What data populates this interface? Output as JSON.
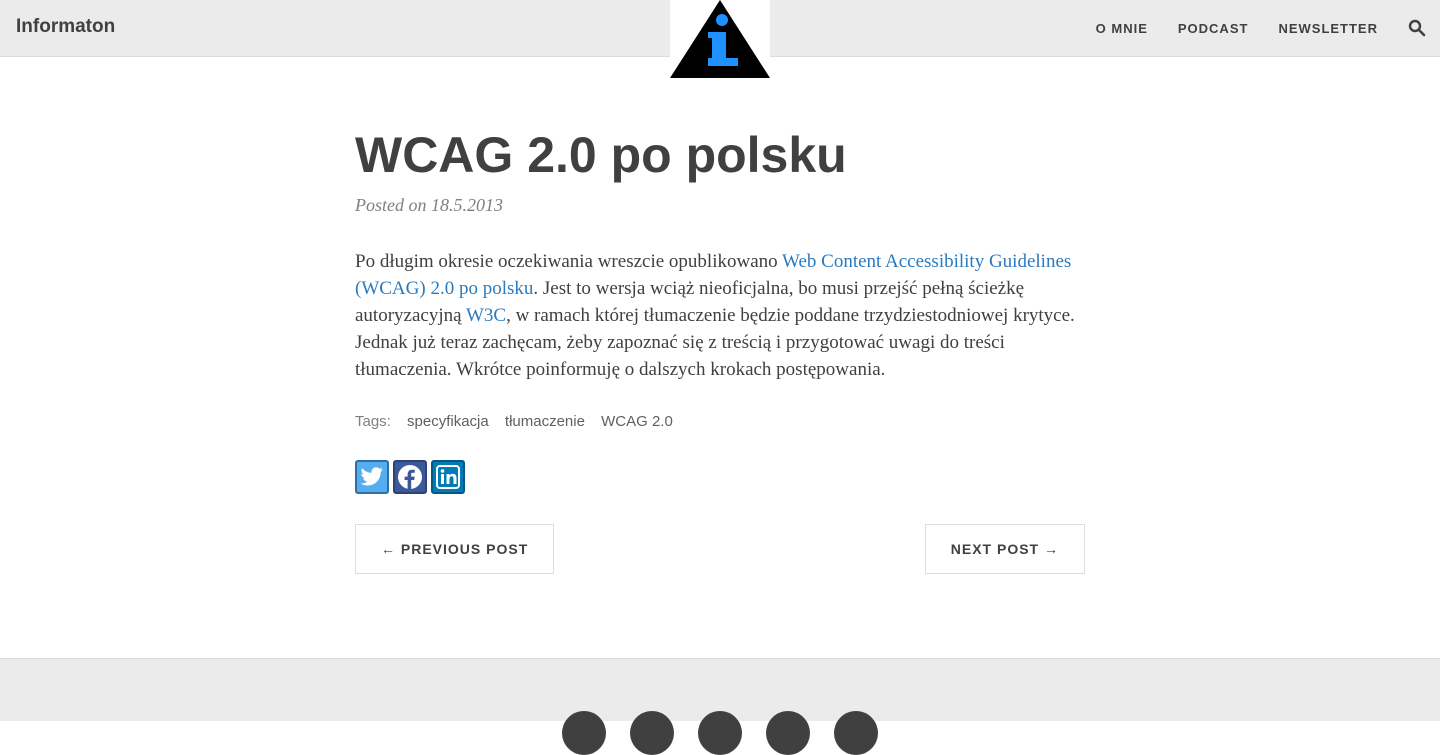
{
  "brand": "Informaton",
  "logo": {
    "icon": "info-triangle-logo",
    "colors": {
      "triangle": "#000000",
      "letter": "#1e90ff"
    }
  },
  "nav": {
    "items": [
      "O MNIE",
      "PODCAST",
      "NEWSLETTER"
    ],
    "search_icon": "search-icon"
  },
  "post": {
    "title": "WCAG 2.0 po polsku",
    "meta": "Posted on 18.5.2013",
    "body": {
      "p1": "Po długim okresie oczekiwania wreszcie opublikowano ",
      "link1": "Web Content Accessibility Guidelines (WCAG) 2.0 po polsku",
      "p2": ". Jest to wersja wciąż nieoficjalna, bo musi przejść pełną ścieżkę autoryzacyjną ",
      "link2": "W3C",
      "p3": ", w ramach której tłumaczenie będzie poddane trzydziestodniowej krytyce. Jednak już teraz zachęcam, żeby zapoznać się z treścią i przygotować uwagi do treści tłumaczenia. Wkrótce poinformuję o dalszych krokach postępowania."
    },
    "tags_label": "Tags:",
    "tags": [
      "specyfikacja",
      "tłumaczenie",
      "WCAG 2.0"
    ]
  },
  "share": {
    "icons": [
      "twitter-icon",
      "facebook-icon",
      "linkedin-icon"
    ],
    "colors": {
      "twitter": "#55acee",
      "facebook": "#3b5998",
      "linkedin": "#007bb6"
    }
  },
  "pager": {
    "prev": "← PREVIOUS POST",
    "next": "NEXT POST →"
  },
  "footer": {
    "social_icons": [
      "social-icon-1",
      "social-icon-2",
      "social-icon-3",
      "social-icon-4",
      "social-icon-5"
    ]
  }
}
